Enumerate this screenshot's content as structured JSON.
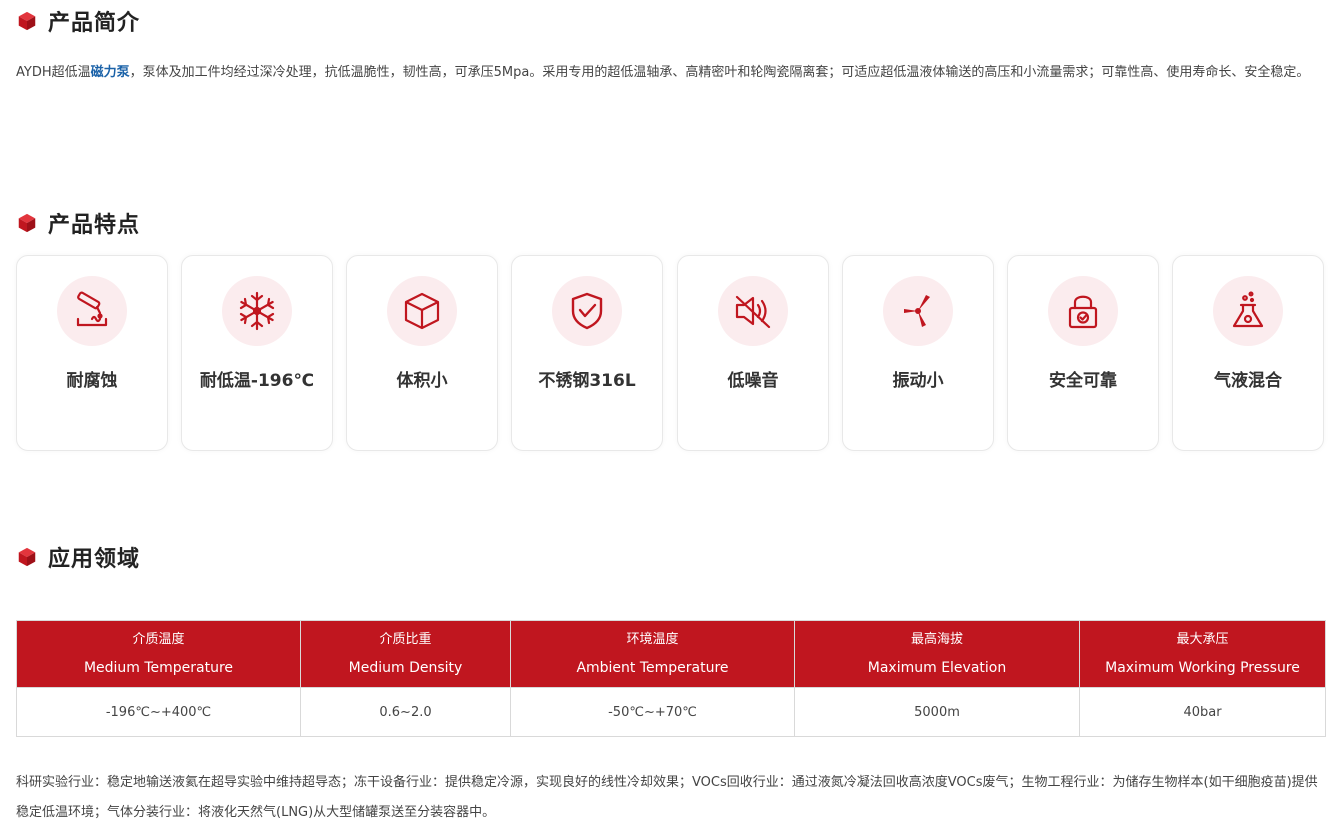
{
  "colors": {
    "accent": "#c0161f",
    "link": "#1b62a8",
    "icon_bg": "#fbecee"
  },
  "intro": {
    "title": "产品简介",
    "text_before": "AYDH超低温",
    "highlight": "磁力泵",
    "text_after": "，泵体及加工件均经过深冷处理，抗低温脆性，韧性高，可承压5Mpa。采用专用的超低温轴承、高精密叶和轮陶瓷隔离套；可适应超低温液体输送的高压和小流量需求；可靠性高、使用寿命长、安全稳定。"
  },
  "features": {
    "title": "产品特点",
    "items": [
      {
        "label": "耐腐蚀",
        "icon": "corrosion-icon"
      },
      {
        "label": "耐低温-196℃",
        "icon": "snowflake-icon"
      },
      {
        "label": "体积小",
        "icon": "cube-box-icon"
      },
      {
        "label": "不锈钢316L",
        "icon": "shield-check-icon"
      },
      {
        "label": "低噪音",
        "icon": "speaker-mute-icon"
      },
      {
        "label": "振动小",
        "icon": "propeller-icon"
      },
      {
        "label": "安全可靠",
        "icon": "padlock-icon"
      },
      {
        "label": "气液混合",
        "icon": "flask-icon"
      }
    ]
  },
  "applications": {
    "title": "应用领域",
    "table": {
      "headers": [
        {
          "cn": "介质温度",
          "en": "Medium Temperature"
        },
        {
          "cn": "介质比重",
          "en": "Medium Density"
        },
        {
          "cn": "环境温度",
          "en": "Ambient Temperature"
        },
        {
          "cn": "最高海拔",
          "en": "Maximum Elevation"
        },
        {
          "cn": "最大承压",
          "en": "Maximum Working Pressure"
        }
      ],
      "row": [
        "-196℃~+400℃",
        "0.6~2.0",
        "-50℃~+70℃",
        "5000m",
        "40bar"
      ]
    },
    "text": "科研实验行业：稳定地输送液氦在超导实验中维持超导态；冻干设备行业：提供稳定冷源，实现良好的线性冷却效果；VOCs回收行业：通过液氮冷凝法回收高浓度VOCs废气；生物工程行业：为储存生物样本(如干细胞疫苗)提供稳定低温环境；气体分装行业：将液化天然气(LNG)从大型储罐泵送至分装容器中。"
  }
}
